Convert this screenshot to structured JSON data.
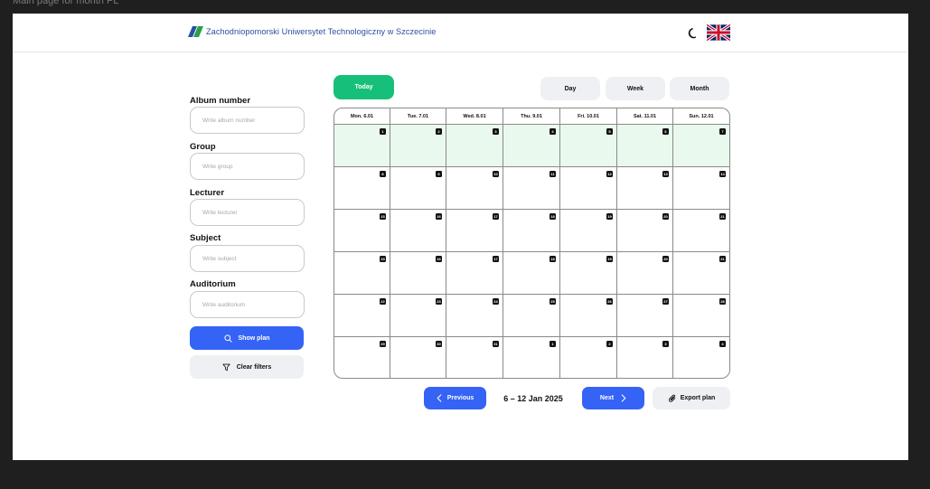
{
  "frame_title": "Main page for month PL",
  "header": {
    "university_name": "Zachodniopomorski Uniwersytet Technologiczny w Szczecinie",
    "theme_icon": "moon-icon",
    "language_icon": "uk-flag-icon"
  },
  "filters": {
    "album": {
      "label": "Album number",
      "placeholder": "Write album number",
      "value": ""
    },
    "group": {
      "label": "Group",
      "placeholder": "Write group",
      "value": ""
    },
    "lecturer": {
      "label": "Lecturer",
      "placeholder": "Write lecturer",
      "value": ""
    },
    "subject": {
      "label": "Subject",
      "placeholder": "Write subject",
      "value": ""
    },
    "auditorium": {
      "label": "Auditorium",
      "placeholder": "Write auditorium",
      "value": ""
    },
    "show_plan_label": "Show plan",
    "clear_filters_label": "Clear filters"
  },
  "toolbar": {
    "today_label": "Today",
    "views": [
      "Day",
      "Week",
      "Month"
    ]
  },
  "calendar": {
    "day_headers": [
      "Mon. 6.01",
      "Tue. 7.01",
      "Wed. 8.01",
      "Thu. 9.01",
      "Fri. 10.01",
      "Sat. 11.01",
      "Sun. 12.01"
    ],
    "weeks": [
      [
        "1",
        "2",
        "3",
        "4",
        "5",
        "6",
        "7"
      ],
      [
        "8",
        "9",
        "10",
        "11",
        "12",
        "13",
        "14"
      ],
      [
        "15",
        "16",
        "17",
        "18",
        "19",
        "20",
        "21"
      ],
      [
        "15",
        "16",
        "17",
        "18",
        "19",
        "20",
        "21"
      ],
      [
        "22",
        "23",
        "24",
        "25",
        "26",
        "27",
        "28"
      ],
      [
        "29",
        "30",
        "31",
        "1",
        "2",
        "3",
        "4"
      ]
    ],
    "highlighted_week_index": 0
  },
  "navigation": {
    "previous_label": "Previous",
    "range_label": "6 – 12 Jan 2025",
    "next_label": "Next",
    "export_label": "Export plan"
  },
  "colors": {
    "accent_blue": "#3563f5",
    "today_green": "#17c07a",
    "current_week_bg": "#eaf9ee",
    "secondary_button": "#eef0f3"
  }
}
